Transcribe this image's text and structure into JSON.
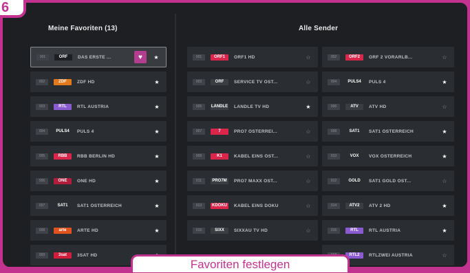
{
  "badge_number": "6",
  "caption": "Favoriten festlegen",
  "favorites": {
    "title": "Meine Favoriten (13)",
    "items": [
      {
        "num": "001",
        "logo": "ORF",
        "name": "DAS ERSTE ...",
        "fav": true,
        "selected": true,
        "logo_color": "#1d1f22"
      },
      {
        "num": "002",
        "logo": "ZDF",
        "name": "ZDF HD",
        "fav": true,
        "logo_color": "#e07a1c"
      },
      {
        "num": "003",
        "logo": "RTL",
        "name": "RTL AUSTRIA",
        "fav": true,
        "logo_color": "#8a5ad0"
      },
      {
        "num": "004",
        "logo": "PULS4",
        "name": "PULS 4",
        "fav": true,
        "logo_color": "#2a2d31"
      },
      {
        "num": "005",
        "logo": "RBB",
        "name": "RBB BERLIN HD",
        "fav": true,
        "logo_color": "#d9264a"
      },
      {
        "num": "006",
        "logo": "ONE",
        "name": "ONE HD",
        "fav": true,
        "logo_color": "#b01e3c"
      },
      {
        "num": "007",
        "logo": "SAT1",
        "name": "SAT1 ÖSTERREICH",
        "fav": true,
        "logo_color": "#2a2d31"
      },
      {
        "num": "008",
        "logo": "arte",
        "name": "ARTE HD",
        "fav": true,
        "logo_color": "#e0531c"
      },
      {
        "num": "009",
        "logo": "3sat",
        "name": "3SAT HD",
        "fav": true,
        "logo_color": "#d01e3c"
      }
    ]
  },
  "all_channels": {
    "title": "Alle Sender",
    "left": [
      {
        "num": "001",
        "logo": "ORF1",
        "name": "ORF1 HD",
        "fav": false
      },
      {
        "num": "003",
        "logo": "ORF",
        "name": "SERVICE TV ÖST...",
        "fav": false
      },
      {
        "num": "005",
        "logo": "LÄNDLE",
        "name": "LÄNDLE TV HD",
        "fav": true
      },
      {
        "num": "007",
        "logo": "7",
        "name": "PRO7 ÖSTERREI...",
        "fav": false
      },
      {
        "num": "009",
        "logo": "K1",
        "name": "KABEL EINS ÖST...",
        "fav": false
      },
      {
        "num": "011",
        "logo": "PRO7M",
        "name": "PRO7 MAXX ÖST...",
        "fav": false
      },
      {
        "num": "013",
        "logo": "KDOKU",
        "name": "KABEL EINS DOKU",
        "fav": false
      },
      {
        "num": "015",
        "logo": "SIXX",
        "name": "SIXXAU TV HD",
        "fav": false
      }
    ],
    "right": [
      {
        "num": "002",
        "logo": "ORF2",
        "name": "ORF 2 VORARLB...",
        "fav": false
      },
      {
        "num": "004",
        "logo": "PULS4",
        "name": "PULS 4",
        "fav": true
      },
      {
        "num": "006",
        "logo": "ATV",
        "name": "ATV HD",
        "fav": false
      },
      {
        "num": "008",
        "logo": "SAT1",
        "name": "SAT1 ÖSTERREICH",
        "fav": true
      },
      {
        "num": "010",
        "logo": "VOX",
        "name": "VOX ÖSTERREICH",
        "fav": true
      },
      {
        "num": "012",
        "logo": "GOLD",
        "name": "SAT1 GOLD ÖST...",
        "fav": false
      },
      {
        "num": "014",
        "logo": "ATV2",
        "name": "ATV 2 HD",
        "fav": true
      },
      {
        "num": "016",
        "logo": "RTL",
        "name": "RTL AUSTRIA",
        "fav": true
      },
      {
        "num": "018",
        "logo": "RTL2",
        "name": "RTLZWEI AUSTRIA",
        "fav": false
      }
    ]
  }
}
